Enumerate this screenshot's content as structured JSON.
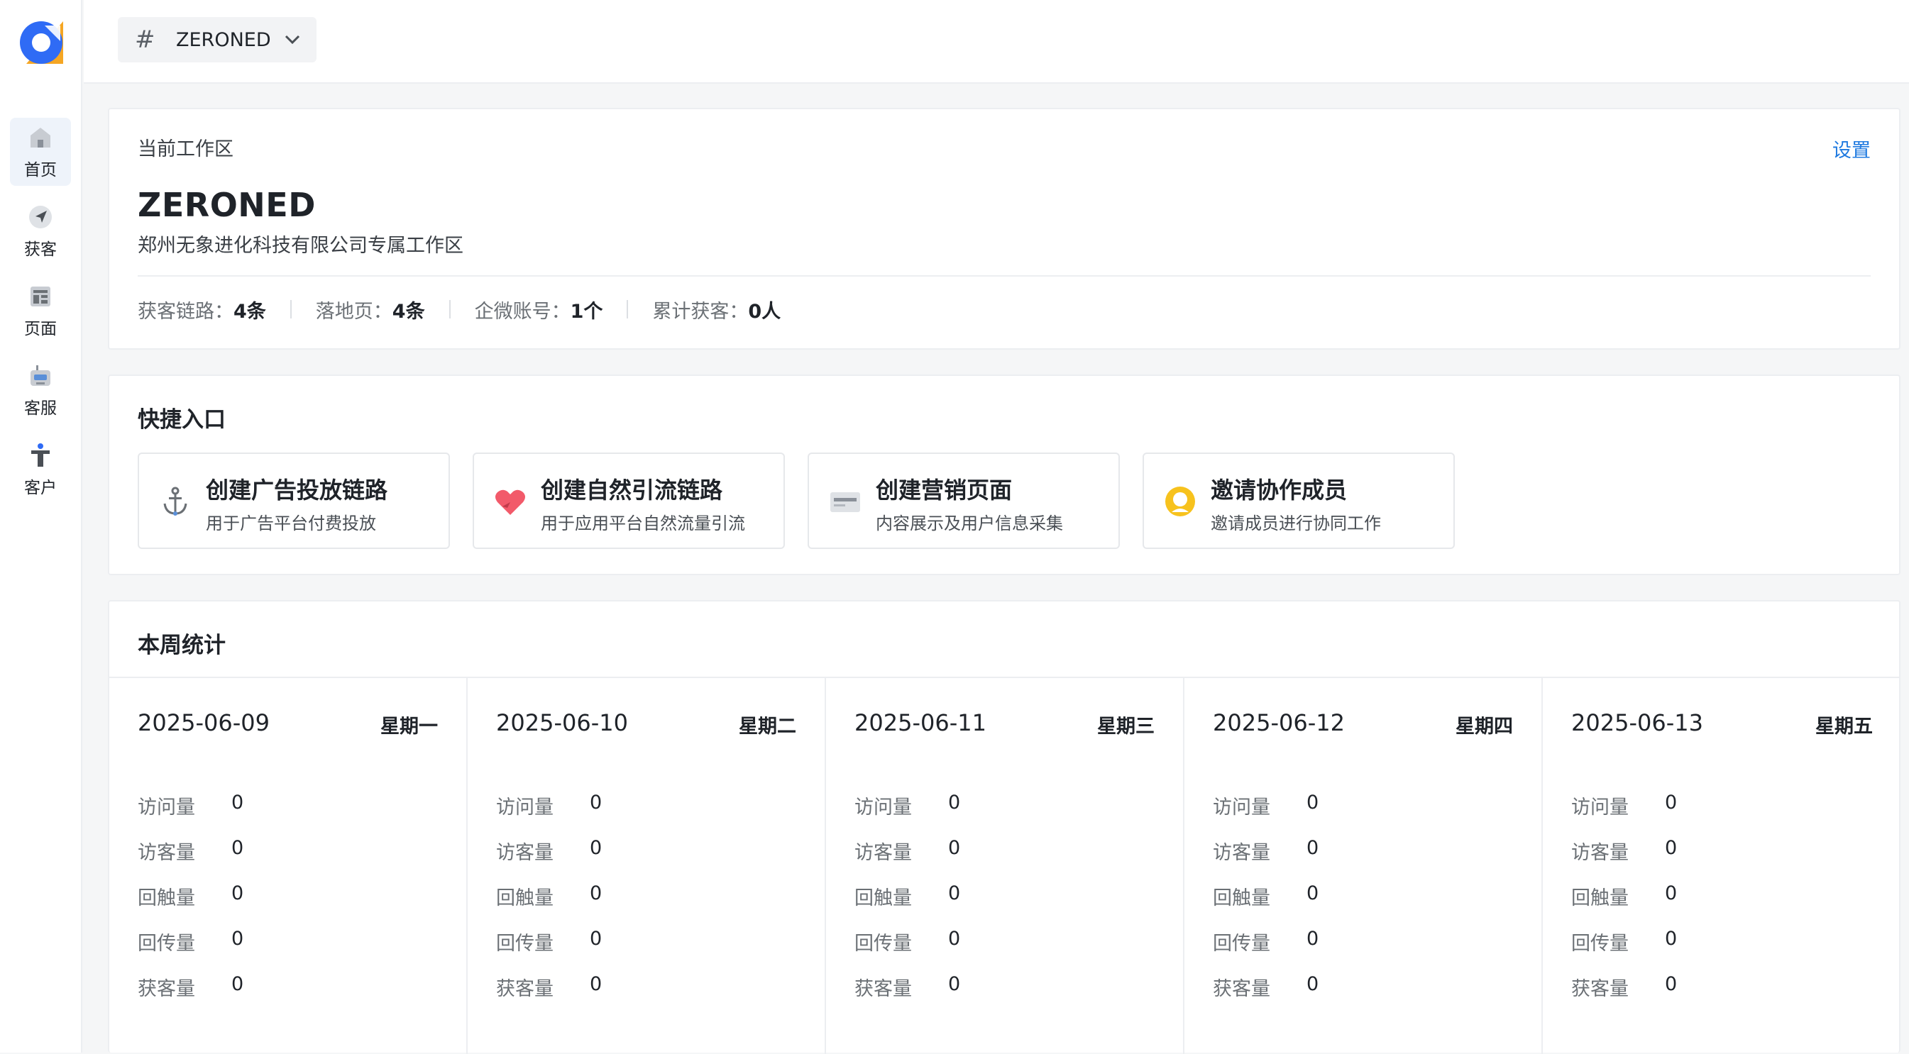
{
  "sidebar": {
    "items": [
      {
        "label": "首页",
        "icon": "home-icon",
        "active": true
      },
      {
        "label": "获客",
        "icon": "send-icon",
        "active": false
      },
      {
        "label": "页面",
        "icon": "page-layout-icon",
        "active": false
      },
      {
        "label": "客服",
        "icon": "robot-icon",
        "active": false
      },
      {
        "label": "客户",
        "icon": "person-icon",
        "active": false
      }
    ]
  },
  "topbar": {
    "workspace_hash": "#",
    "workspace_name": "ZERONED"
  },
  "workspace": {
    "label": "当前工作区",
    "settings": "设置",
    "title": "ZERONED",
    "description": "郑州无象进化科技有限公司专属工作区",
    "stats": [
      {
        "label": "获客链路：",
        "value": "4条"
      },
      {
        "label": "落地页：",
        "value": "4条"
      },
      {
        "label": "企微账号：",
        "value": "1个"
      },
      {
        "label": "累计获客：",
        "value": "0人"
      }
    ]
  },
  "quick": {
    "title": "快捷入口",
    "items": [
      {
        "title": "创建广告投放链路",
        "subtitle": "用于广告平台付费投放",
        "icon": "anchor-icon"
      },
      {
        "title": "创建自然引流链路",
        "subtitle": "用于应用平台自然流量引流",
        "icon": "heart-icon"
      },
      {
        "title": "创建营销页面",
        "subtitle": "内容展示及用户信息采集",
        "icon": "card-icon"
      },
      {
        "title": "邀请协作成员",
        "subtitle": "邀请成员进行协同工作",
        "icon": "user-circle-icon"
      }
    ]
  },
  "weekly": {
    "title": "本周统计",
    "metric_labels": [
      "访问量",
      "访客量",
      "回触量",
      "回传量",
      "获客量"
    ],
    "days": [
      {
        "date": "2025-06-09",
        "weekday": "星期一",
        "values": [
          "0",
          "0",
          "0",
          "0",
          "0"
        ]
      },
      {
        "date": "2025-06-10",
        "weekday": "星期二",
        "values": [
          "0",
          "0",
          "0",
          "0",
          "0"
        ]
      },
      {
        "date": "2025-06-11",
        "weekday": "星期三",
        "values": [
          "0",
          "0",
          "0",
          "0",
          "0"
        ]
      },
      {
        "date": "2025-06-12",
        "weekday": "星期四",
        "values": [
          "0",
          "0",
          "0",
          "0",
          "0"
        ]
      },
      {
        "date": "2025-06-13",
        "weekday": "星期五",
        "values": [
          "0",
          "0",
          "0",
          "0",
          "0"
        ]
      }
    ]
  },
  "colors": {
    "accent": "#1f7ae0",
    "logo_blue": "#2f6bf5",
    "logo_orange": "#f5a623",
    "heart": "#f25a6a",
    "user_icon": "#f7c21d"
  }
}
